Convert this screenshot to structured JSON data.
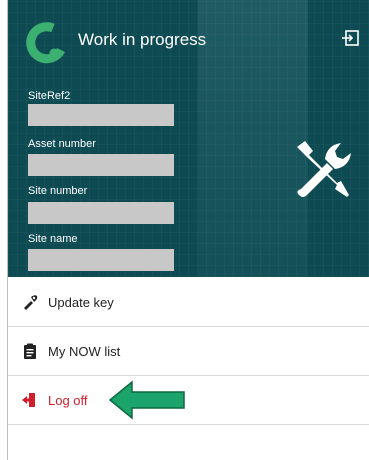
{
  "app": {
    "title": "Work in progress"
  },
  "fields": [
    {
      "label": "SiteRef2",
      "value": ""
    },
    {
      "label": "Asset number",
      "value": ""
    },
    {
      "label": "Site number",
      "value": ""
    },
    {
      "label": "Site name",
      "value": ""
    }
  ],
  "menu": [
    {
      "label": "Update key",
      "icon": "key-icon"
    },
    {
      "label": "My NOW list",
      "icon": "clipboard-icon"
    },
    {
      "label": "Log off",
      "icon": "log-off-icon"
    }
  ],
  "colors": {
    "header_bg": "#0d4a52",
    "brand_green": "#3bb071",
    "logoff_red": "#d01e2a",
    "field_placeholder": "#c8c8c8",
    "annotation_arrow": "#1aa36a"
  },
  "icons": {
    "logo": "app-logo-icon",
    "exit": "exit-icon",
    "tools": "wrench-screwdriver-icon"
  }
}
